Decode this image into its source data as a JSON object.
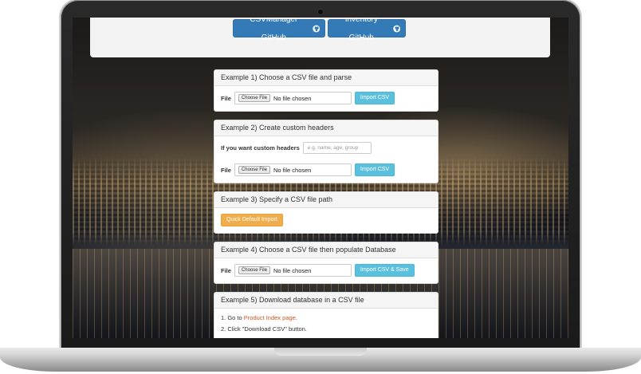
{
  "header": {
    "csvmanager_btn": "CSVManager GitHub",
    "inventory_btn": "Inventory GitHub"
  },
  "example1": {
    "title": "Example 1) Choose a CSV file and parse",
    "file_label": "File",
    "choose_label": "Choose File",
    "no_file": "No file chosen",
    "button": "Import CSV"
  },
  "example2": {
    "title": "Example 2) Create custom headers",
    "custom_label": "If you want custom headers",
    "placeholder": "e.g. name, age, group",
    "file_label": "File",
    "choose_label": "Choose File",
    "no_file": "No file chosen",
    "button": "Import CSV"
  },
  "example3": {
    "title": "Example 3) Specify a CSV file path",
    "button": "Quick Default Import"
  },
  "example4": {
    "title": "Example 4) Choose a CSV file then populate Database",
    "file_label": "File",
    "choose_label": "Choose File",
    "no_file": "No file chosen",
    "button": "Import CSV & Save"
  },
  "example5": {
    "title": "Example 5) Download database in a CSV file",
    "step1_prefix": "1. Go to ",
    "step1_link": "Product Index page",
    "step1_suffix": ".",
    "step2": "2. Click \"Download CSV\" button."
  },
  "colors": {
    "primary": "#337ab7",
    "info": "#5bc0de",
    "warning": "#f0ad4e",
    "link": "#d9531e"
  }
}
